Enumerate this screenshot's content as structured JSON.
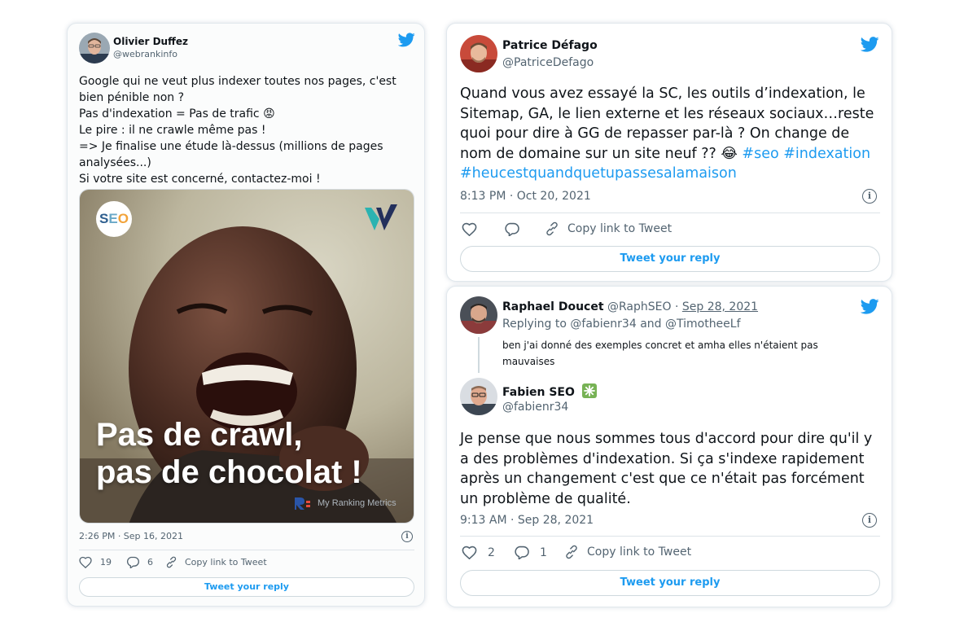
{
  "tweet1": {
    "author_name": "Olivier Duffez",
    "author_handle": "@webrankinfo",
    "text_lines": [
      "Google qui ne veut plus indexer toutes nos pages, c'est",
      "bien pénible non ?",
      "Pas d'indexation = Pas de trafic 😡",
      "Le pire : il ne crawle même pas !",
      "=> Je finalise une étude là-dessus (millions de pages",
      "analysées...)",
      "Si votre site est concerné, contactez-moi !"
    ],
    "media": {
      "badge_text": "SEO",
      "caption_line1": "Pas de crawl,",
      "caption_line2": "pas de chocolat !",
      "watermark": "My Ranking Metrics"
    },
    "timestamp": "2:26 PM · Sep 16, 2021",
    "likes": "19",
    "replies": "6",
    "copy_link_label": "Copy link to Tweet",
    "reply_button_label": "Tweet your reply"
  },
  "tweet2": {
    "author_name": "Patrice Défago",
    "author_handle": "@PatriceDefago",
    "text_lines": [
      "Quand vous avez essayé la SC, les outils d’indexation, le",
      "Sitemap, GA, le lien externe et les réseaux sociaux…reste",
      "quoi pour dire à GG de repasser par-là ? On change de"
    ],
    "text_line4_plain": "nom de domaine sur un site neuf ?? 😂 ",
    "hashtag_seo": "#seo",
    "hashtag_indexation": "#indexation",
    "hashtag_long": "#heucestquandquetupassesalamaison",
    "timestamp": "8:13 PM · Oct 20, 2021",
    "copy_link_label": "Copy link to Tweet",
    "reply_button_label": "Tweet your reply"
  },
  "tweet3": {
    "parent": {
      "author_name": "Raphael Doucet",
      "author_handle": "@RaphSEO",
      "separator": "·",
      "date": "Sep 28, 2021",
      "replying_prefix": "Replying to",
      "replying_user1": "@fabienr34",
      "replying_and": "and",
      "replying_user2": "@TimotheeLf",
      "text_line1": "ben j'ai donné des exemples concret et amha elles n'étaient pas",
      "text_line2": "mauvaises"
    },
    "author_name": "Fabien SEO",
    "author_badge": "✳️",
    "author_handle": "@fabienr34",
    "text_lines": [
      "Je pense que nous sommes tous d'accord pour dire qu'il y",
      "a des problèmes d'indexation. Si ça s'indexe rapidement",
      "après un changement c'est que ce n'était pas forcément",
      "un problème de qualité."
    ],
    "timestamp": "9:13 AM · Sep 28, 2021",
    "likes": "2",
    "replies": "1",
    "copy_link_label": "Copy link to Tweet",
    "reply_button_label": "Tweet your reply"
  },
  "colors": {
    "twitter_blue": "#1d9bf0",
    "muted_text": "#536471",
    "border": "#e1e8ed"
  },
  "icons": [
    "twitter-bird-icon",
    "heart-icon",
    "reply-icon",
    "link-icon",
    "info-icon"
  ]
}
